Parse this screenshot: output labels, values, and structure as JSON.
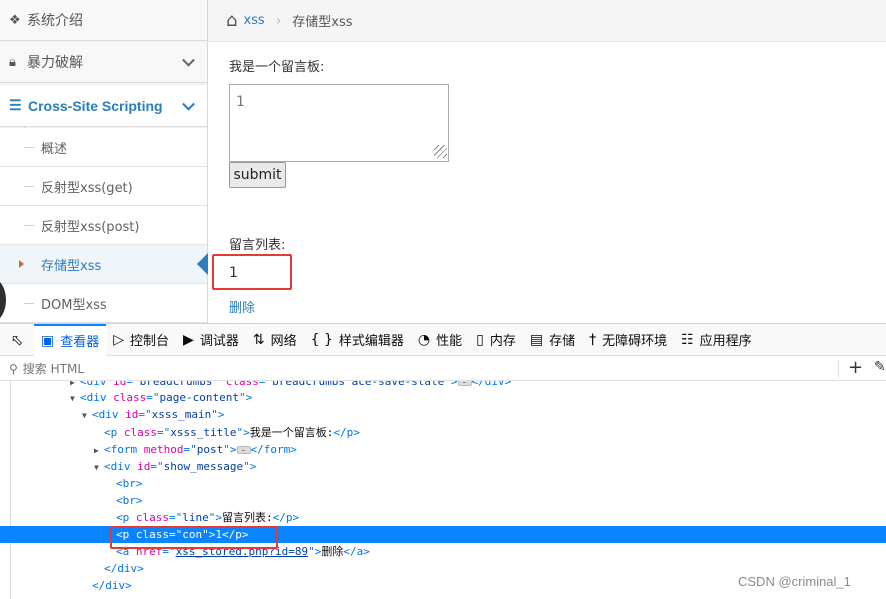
{
  "sidebar": {
    "system_intro": "系统介绍",
    "brute_force": "暴力破解",
    "xss_title": "Cross-Site Scripting",
    "sub_items": [
      "概述",
      "反射型xss(get)",
      "反射型xss(post)",
      "存储型xss",
      "DOM型xss"
    ],
    "active_index": 3
  },
  "breadcrumb": {
    "link": "xss",
    "current": "存储型xss"
  },
  "board": {
    "title": "我是一个留言板:",
    "textarea_value": "1",
    "submit_label": "submit",
    "list_label": "留言列表:",
    "message": "1",
    "delete_label": "删除"
  },
  "devtools": {
    "tabs": [
      {
        "label": "查看器",
        "icon": "inspector-icon"
      },
      {
        "label": "控制台",
        "icon": "console-icon"
      },
      {
        "label": "调试器",
        "icon": "debugger-icon"
      },
      {
        "label": "网络",
        "icon": "network-icon"
      },
      {
        "label": "样式编辑器",
        "icon": "style-editor-icon"
      },
      {
        "label": "性能",
        "icon": "performance-icon"
      },
      {
        "label": "内存",
        "icon": "memory-icon"
      },
      {
        "label": "存储",
        "icon": "storage-icon"
      },
      {
        "label": "无障碍环境",
        "icon": "accessibility-icon"
      },
      {
        "label": "应用程序",
        "icon": "application-icon"
      }
    ],
    "search_placeholder": "搜索 HTML",
    "nodes": [
      {
        "tag": "div",
        "attrs": [
          [
            "id",
            "breadcrumbs"
          ],
          [
            "class",
            "breadcrumbs ace-save-state"
          ]
        ],
        "collapsed": true,
        "cut": true
      },
      {
        "tag": "div",
        "attrs": [
          [
            "class",
            "page-content"
          ]
        ],
        "open": true
      },
      {
        "tag": "div",
        "attrs": [
          [
            "id",
            "xsss_main"
          ]
        ],
        "open": true
      },
      {
        "tag": "p",
        "attrs": [
          [
            "class",
            "xsss_title"
          ]
        ],
        "text": "我是一个留言板:",
        "close": true
      },
      {
        "tag": "form",
        "attrs": [
          [
            "method",
            "post"
          ]
        ],
        "collapsed": true
      },
      {
        "tag": "div",
        "attrs": [
          [
            "id",
            "show_message"
          ]
        ],
        "open": true
      },
      {
        "tag": "br",
        "attrs": []
      },
      {
        "tag": "br",
        "attrs": []
      },
      {
        "tag": "p",
        "attrs": [
          [
            "class",
            "line"
          ]
        ],
        "text": "留言列表:",
        "close": true
      },
      {
        "tag": "p",
        "attrs": [
          [
            "class",
            "con"
          ]
        ],
        "text": "1",
        "close": true,
        "selected": true
      },
      {
        "tag": "a",
        "attrs": [
          [
            "href",
            "xss_stored.php?id=89"
          ]
        ],
        "text": "删除",
        "close": true
      },
      {
        "closing": "div"
      },
      {
        "closing": "div"
      }
    ]
  },
  "watermark": "CSDN @criminal_1"
}
